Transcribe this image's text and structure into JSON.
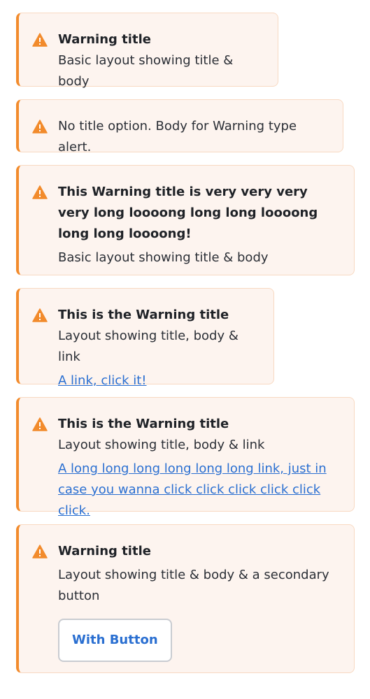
{
  "colors": {
    "accent": "#f28b2c",
    "background": "#fdf4ef",
    "border": "#f8d9c2",
    "link": "#2a6fd1"
  },
  "alerts": [
    {
      "icon": "warning-triangle-icon",
      "title": "Warning title",
      "body": "Basic layout showing title & body"
    },
    {
      "icon": "warning-triangle-icon",
      "body": "No title option. Body for Warning type alert."
    },
    {
      "icon": "warning-triangle-icon",
      "title": "This Warning title is very very very very  long loooong long long loooong long long loooong!",
      "body": "Basic layout showing title & body"
    },
    {
      "icon": "warning-triangle-icon",
      "title": "This is the Warning title",
      "body": "Layout showing title, body & link",
      "link": "A link, click it!"
    },
    {
      "icon": "warning-triangle-icon",
      "title": "This is the Warning title",
      "body": "Layout showing title, body & link",
      "link": "A long long long long long long link, just in case you wanna click click click click click click."
    },
    {
      "icon": "warning-triangle-icon",
      "title": "Warning title",
      "body": "Layout showing title & body & a secondary button",
      "button": "With Button"
    }
  ]
}
